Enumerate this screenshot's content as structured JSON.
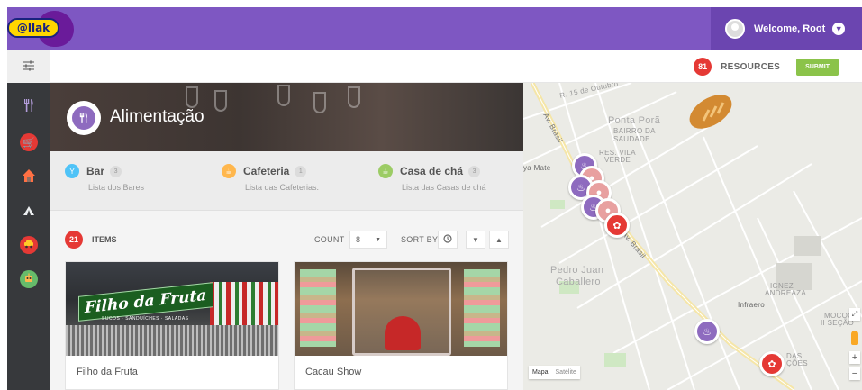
{
  "header": {
    "logo_text": "@llak",
    "welcome": "Welcome, Root",
    "user_chevron": "chevron-down-icon"
  },
  "subbar": {
    "filter_icon": "sliders-icon",
    "resources_count": "81",
    "resources_label": "RESOURCES",
    "submit_label": "SUBMIT"
  },
  "sidebar": {
    "items": [
      {
        "icon": "fork-knife-icon",
        "color": "#8e6bbf",
        "active": true
      },
      {
        "icon": "cart-icon",
        "color": "#e53935"
      },
      {
        "icon": "house-icon",
        "color": "#ff7043"
      },
      {
        "icon": "tent-icon",
        "color": "#eceff1"
      },
      {
        "icon": "car-icon",
        "color": "#e53935"
      },
      {
        "icon": "robot-icon",
        "color": "#66bb6a"
      }
    ]
  },
  "hero": {
    "title": "Alimentação",
    "icon": "fork-knife-icon"
  },
  "categories": [
    {
      "name": "Bar",
      "count": "3",
      "desc": "Lista dos Bares",
      "icon": "cocktail-icon",
      "color": "#4fc3f7"
    },
    {
      "name": "Cafeteria",
      "count": "1",
      "desc": "Lista das Cafeterias.",
      "icon": "coffee-icon",
      "color": "#ffb74d"
    },
    {
      "name": "Casa de chá",
      "count": "3",
      "desc": "Lista das Casas de chá",
      "icon": "teacup-icon",
      "color": "#9ccc65"
    }
  ],
  "items_bar": {
    "count": "21",
    "label": "ITEMS",
    "count_label": "COUNT",
    "count_value": "8",
    "sort_label": "SORT BY"
  },
  "cards": [
    {
      "title": "Filho da Fruta",
      "sign_text": "Filho da Fruta",
      "sign_sub": "SUCOS · SANDUÍCHES · SALADAS"
    },
    {
      "title": "Cacau Show"
    }
  ],
  "map": {
    "labels": {
      "street_top": "R. 15 de Outubro",
      "ponta_pora": "Ponta Porã",
      "bairro": "BAIRRO DA",
      "saudade": "SAUDADE",
      "res_vila": "RES. VILA",
      "verde": "VERDE",
      "ya_mate": "ya Mate",
      "pedro": "Pedro Juan",
      "caballero": "Caballero",
      "av_brasil": "Av. Brasil",
      "av_brasil2": "Av. Brasil",
      "infraero": "Infraero",
      "ignez": "IGNEZ",
      "andreaza": "ANDREAZA",
      "mococ": "MOCOC",
      "secao": "II SEÇÃO",
      "das": "DAS",
      "coes": "ÇÕES"
    },
    "type_map": "Mapa",
    "type_sat": "Satélite",
    "zoom_in": "+",
    "zoom_out": "−"
  }
}
